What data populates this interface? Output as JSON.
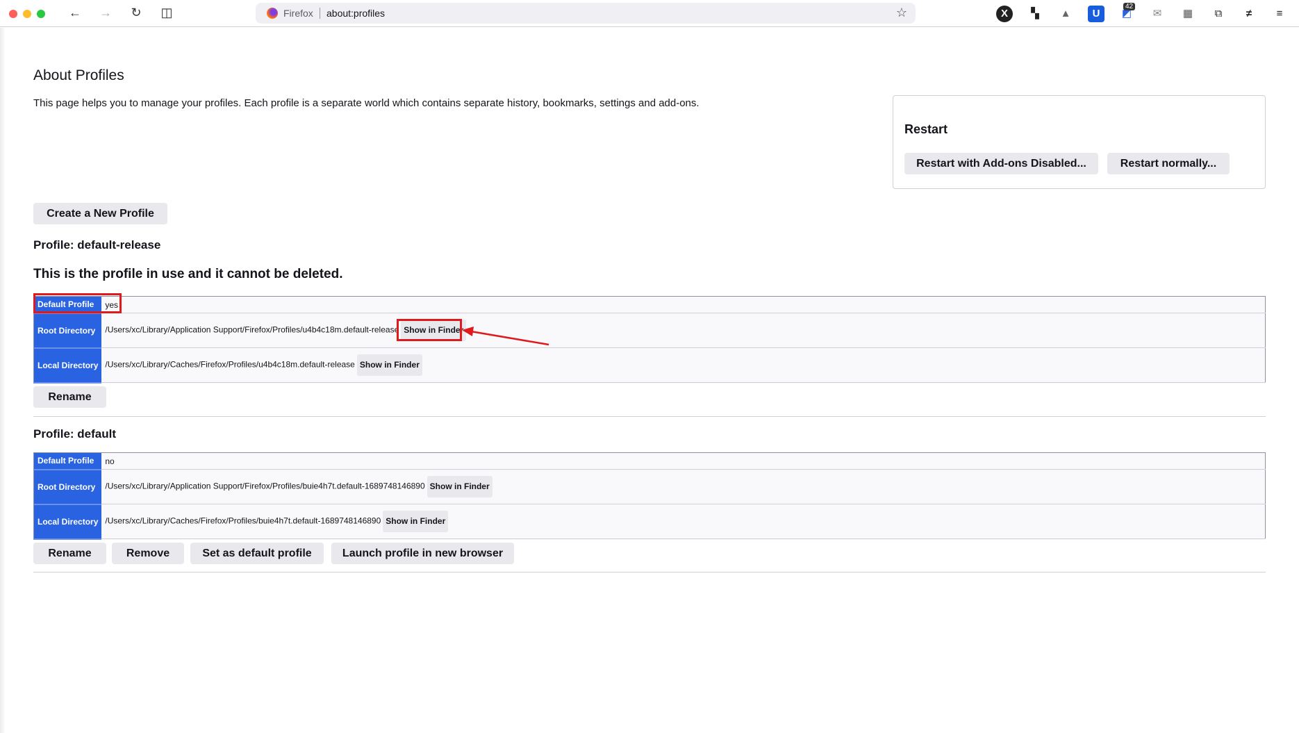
{
  "browser": {
    "brand": "Firefox",
    "url": "about:profiles",
    "notification_count": "42",
    "extensions": [
      "x-icon",
      "grid-plus-icon",
      "rocket-icon",
      "bitwarden-icon",
      "notification-icon",
      "mail-icon",
      "qr-code-icon",
      "extensions-puzzle-icon",
      "stripes-icon",
      "menu-icon"
    ]
  },
  "page": {
    "title": "About Profiles",
    "intro": "This page helps you to manage your profiles. Each profile is a separate world which contains separate history, bookmarks, settings and add-ons.",
    "create_button": "Create a New Profile"
  },
  "restart": {
    "title": "Restart",
    "addons_disabled": "Restart with Add-ons Disabled...",
    "normally": "Restart normally..."
  },
  "profiles": [
    {
      "heading": "Profile: default-release",
      "warning": "This is the profile in use and it cannot be deleted.",
      "rows": [
        {
          "label": "Default Profile",
          "value": "yes"
        },
        {
          "label": "Root Directory",
          "value": "/Users/xc/Library/Application Support/Firefox/Profiles/u4b4c18m.default-release",
          "button": "Show in Finder"
        },
        {
          "label": "Local Directory",
          "value": "/Users/xc/Library/Caches/Firefox/Profiles/u4b4c18m.default-release",
          "button": "Show in Finder"
        }
      ],
      "buttons": [
        "Rename"
      ]
    },
    {
      "heading": "Profile: default",
      "rows": [
        {
          "label": "Default Profile",
          "value": "no"
        },
        {
          "label": "Root Directory",
          "value": "/Users/xc/Library/Application Support/Firefox/Profiles/buie4h7t.default-1689748146890",
          "button": "Show in Finder"
        },
        {
          "label": "Local Directory",
          "value": "/Users/xc/Library/Caches/Firefox/Profiles/buie4h7t.default-1689748146890",
          "button": "Show in Finder"
        }
      ],
      "buttons": [
        "Rename",
        "Remove",
        "Set as default profile",
        "Launch profile in new browser"
      ]
    }
  ],
  "annotation_color": "#e0191c",
  "accent": "#2a63e2"
}
